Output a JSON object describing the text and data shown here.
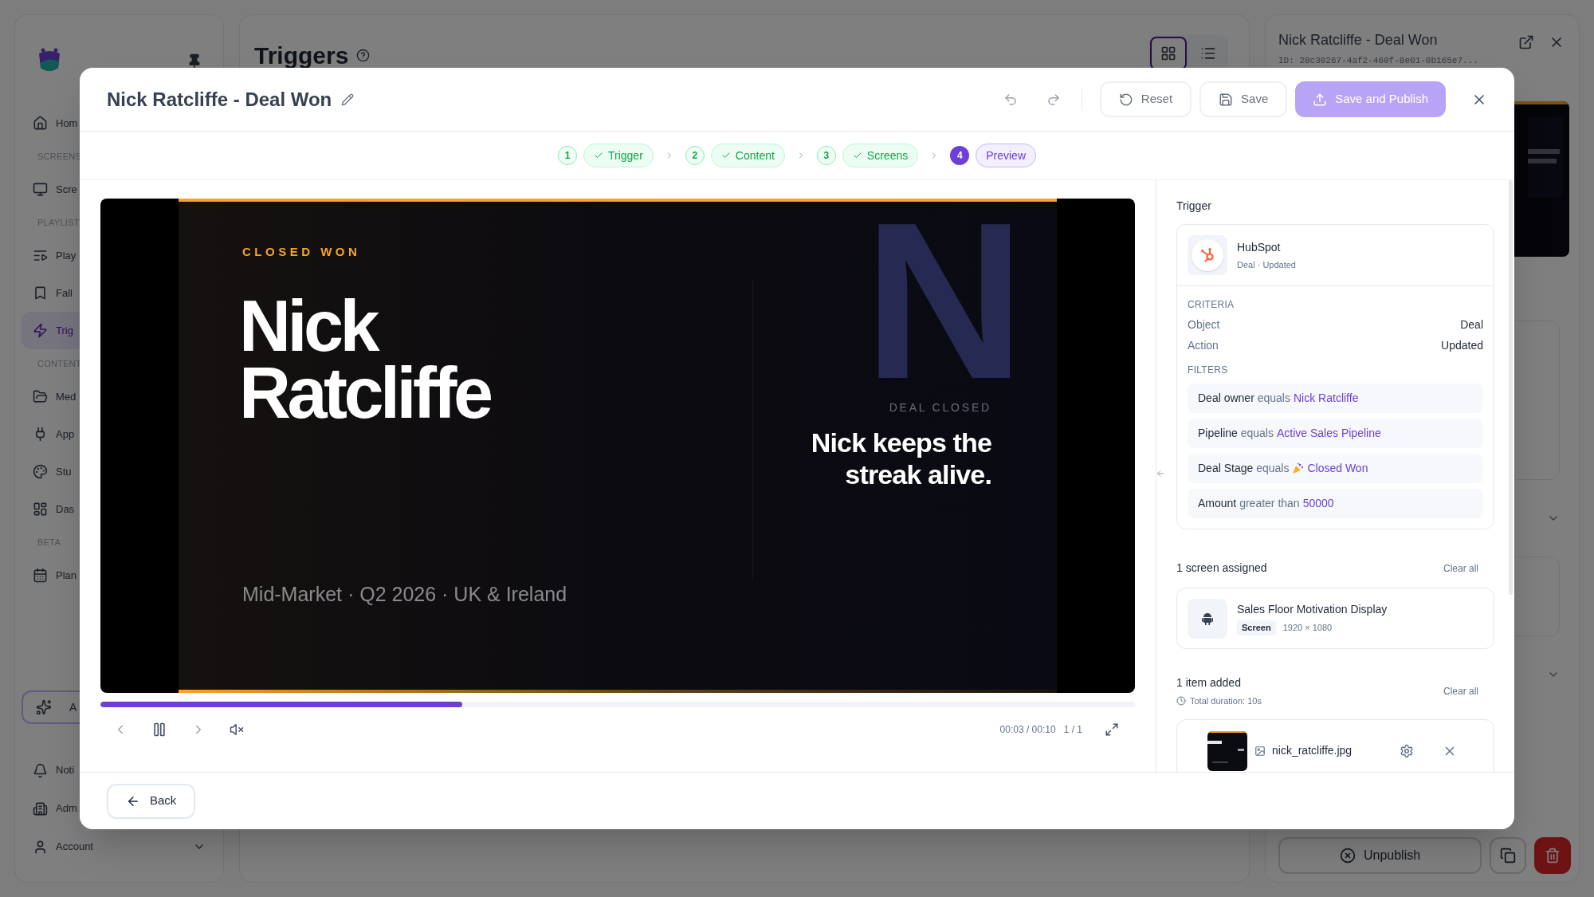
{
  "sidebar": {
    "items": [
      {
        "kind": "item",
        "label": "Hom",
        "selected": false
      },
      {
        "kind": "section",
        "label": "SCREENS"
      },
      {
        "kind": "item",
        "label": "Scre",
        "selected": false
      },
      {
        "kind": "section",
        "label": "PLAYLIST"
      },
      {
        "kind": "item",
        "label": "Play",
        "selected": false
      },
      {
        "kind": "item",
        "label": "Fall",
        "selected": false
      },
      {
        "kind": "item",
        "label": "Trig",
        "selected": true
      },
      {
        "kind": "section",
        "label": "CONTENT"
      },
      {
        "kind": "item",
        "label": "Med",
        "selected": false
      },
      {
        "kind": "item",
        "label": "App",
        "selected": false
      },
      {
        "kind": "item",
        "label": "Stu",
        "selected": false
      },
      {
        "kind": "item",
        "label": "Das",
        "selected": false
      },
      {
        "kind": "section",
        "label": "BETA"
      },
      {
        "kind": "item",
        "label": "Plan",
        "selected": false
      }
    ],
    "ai_button": "A",
    "bottom_items": [
      {
        "label": "Noti"
      },
      {
        "label": "Adm"
      },
      {
        "label": "Account"
      }
    ]
  },
  "main": {
    "title": "Triggers",
    "views": [
      {
        "selected": true
      },
      {
        "selected": false
      }
    ]
  },
  "detail_panel": {
    "title": "Nick Ratcliffe - Deal Won",
    "id": "ID: 28c30267-4af2-460f-8e01-0b165e7...",
    "unpublish": "Unpublish"
  },
  "modal": {
    "title": "Nick Ratcliffe - Deal Won",
    "buttons": [
      {
        "kind": "outline",
        "label": "Reset"
      },
      {
        "kind": "outline",
        "label": "Save"
      },
      {
        "kind": "primary",
        "label": "Save and Publish"
      }
    ],
    "steps": [
      {
        "number": "1",
        "label": "Trigger",
        "done": true,
        "selected": false
      },
      {
        "number": "2",
        "label": "Content",
        "done": true,
        "selected": false
      },
      {
        "number": "3",
        "label": "Screens",
        "done": true,
        "selected": false
      },
      {
        "number": "4",
        "label": "Preview",
        "done": false,
        "selected": true
      }
    ],
    "slide": {
      "eyebrow": "CLOSED WON",
      "name_lines": [
        "Nick",
        "Ratcliffe"
      ],
      "backdrop_letter": "N",
      "tag": "DEAL CLOSED",
      "headline_lines": [
        "Nick keeps the",
        "streak alive."
      ],
      "footer": "Mid-Market · Q2 2026 · UK & Ireland"
    },
    "player": {
      "level": 0.35,
      "time": "00:03 / 00:10",
      "count": "1 / 1"
    },
    "trigger": {
      "heading": "Trigger",
      "source": "HubSpot",
      "event": "Deal · Updated",
      "criteria_label": "CRITERIA",
      "criteria": [
        {
          "key": "Object",
          "value": "Deal"
        },
        {
          "key": "Action",
          "value": "Updated"
        }
      ],
      "filters_label": "FILTERS",
      "filters": [
        {
          "kind": "plain",
          "field": "Deal owner",
          "operator": "equals",
          "value": "Nick Ratcliffe"
        },
        {
          "kind": "plain",
          "field": "Pipeline",
          "operator": "equals",
          "value": "Active Sales Pipeline"
        },
        {
          "kind": "party",
          "field": "Deal Stage",
          "operator": "equals",
          "value": "Closed Won"
        },
        {
          "kind": "plain",
          "field": "Amount",
          "operator": "greater than",
          "value": "50000"
        }
      ]
    },
    "screens": {
      "heading": "1 screen assigned",
      "clear": "Clear all",
      "items": [
        {
          "name": "Sales Floor Motivation Display",
          "badge": "Screen",
          "resolution": "1920 × 1080"
        }
      ]
    },
    "content": {
      "heading": "1 item added",
      "duration": "Total duration: 10s",
      "clear": "Clear all",
      "items": [
        {
          "file": "nick_ratcliffe.jpg"
        }
      ]
    },
    "back": "Back"
  }
}
